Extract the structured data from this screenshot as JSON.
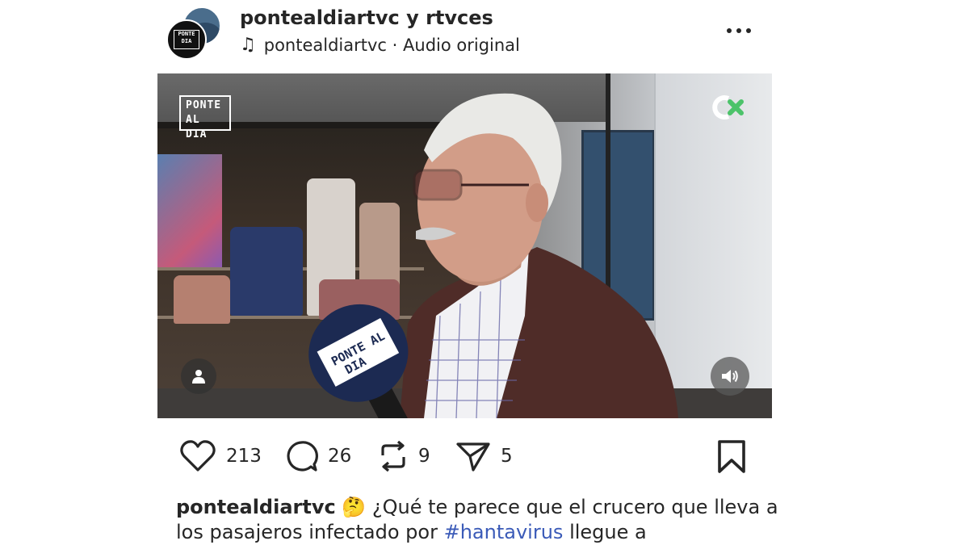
{
  "post": {
    "authors": "pontealdiartvc y rtvces",
    "audio_owner": "pontealdiartvc",
    "audio_separator": "·",
    "audio_label": "Audio original"
  },
  "video": {
    "brand_logo_text_line1": "PONTE AL",
    "brand_logo_text_line2": "DIA",
    "mic_logo_text_line1": "PONTE AL",
    "mic_logo_text_line2": "DIA"
  },
  "actions": {
    "likes": "213",
    "comments": "26",
    "reposts": "9",
    "shares": "5"
  },
  "caption": {
    "username": "pontealdiartvc",
    "emoji": "🤔",
    "text_part1": "¿Qué te parece que el crucero que lleva a los pasajeros infectado por",
    "hashtag": "#hantavirus",
    "text_part2": "llegue a"
  },
  "colors": {
    "hashtag": "#3b5bb8",
    "channel_logo_green": "#4cc36a"
  }
}
